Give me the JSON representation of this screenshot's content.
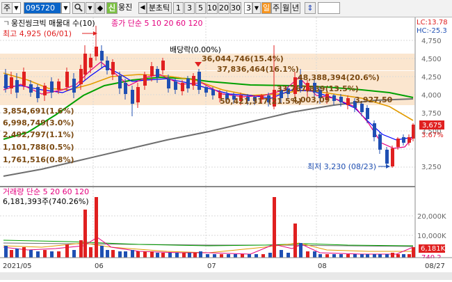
{
  "toolbar": {
    "market_label": "주",
    "code": "095720",
    "search_icon": "search-icon",
    "new_badge": "신",
    "name": "웅진",
    "prev_label": "◀",
    "period_unit": "분초틱",
    "intervals": [
      "1",
      "3",
      "5",
      "10",
      "20",
      "30"
    ],
    "interval_value": "3",
    "day_label": "일",
    "week_label": "주",
    "month_label": "월",
    "year_label": "년",
    "updown_icon": "updown-arrow-icon"
  },
  "price_panel": {
    "legend_stock": "웅진씽크빅 매물대 수(10)",
    "legend_ma": "종가 단순 5 10 20 60 120",
    "ma_colors": {
      "ma5": "#e4007f",
      "ma10": "#0000ff",
      "ma20": "#e39b00",
      "ma60": "#00a000",
      "ma120": "#6e6e6e"
    },
    "lc_label": "LC:13.78",
    "hc_label": "HC:-25.3",
    "max_label": "최고 4,925 (06/01)",
    "min_label": "최저 3,230 (08/23)",
    "dividend_label": "배당락(0.00%)",
    "current_price": "3,675",
    "current_pct": "3.67%",
    "y_ticks": [
      "4,750",
      "4,500",
      "4,250",
      "4,000",
      "3,750",
      "3,500",
      "3,250"
    ],
    "volume_profile": [
      "36,044,746(15.4%)",
      "37,836,464(16.1%)",
      "48,388,394(20.6%)",
      "33,767,839(13.5%)",
      "50,421,317(21.5%)",
      "4,003,09",
      "3,927,50",
      "3,854,691(1.6%)",
      "6,998,749(3.0%)",
      "2,492,797(1.1%)",
      "1,101,788(0.5%)",
      "1,761,516(0.8%)"
    ]
  },
  "volume_panel": {
    "legend": "거래량 단순 5 20 60 120",
    "value_label": "6,181,393주(740.26%)",
    "y_ticks": [
      "20,000K",
      "10,000K"
    ],
    "current_badge": "6,181K",
    "pct_badge": "740.2"
  },
  "x_axis": {
    "labels": [
      "2021/05",
      "06",
      "07",
      "08",
      "08/27"
    ]
  }
}
